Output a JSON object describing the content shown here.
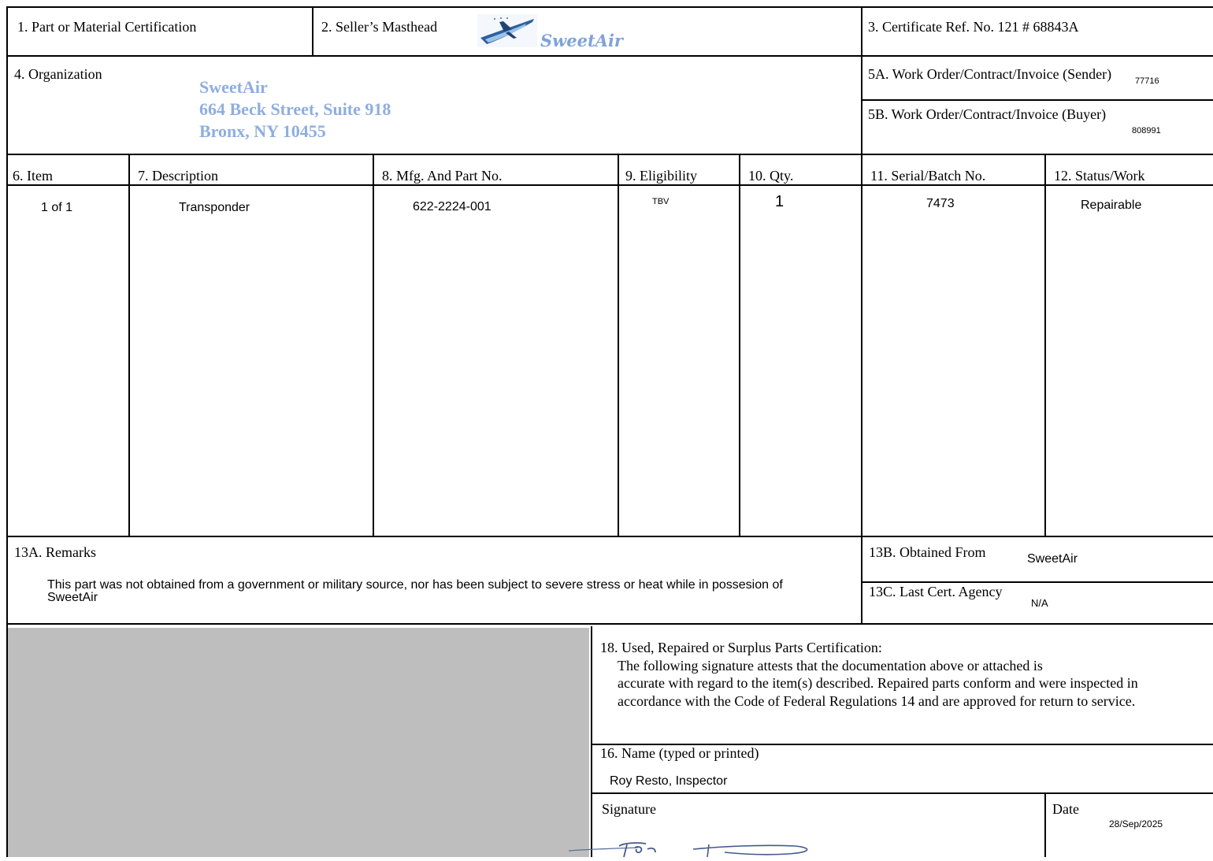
{
  "header": {
    "box1_label": "1. Part or Material Certification",
    "box2_label": "2. Seller’s Masthead",
    "masthead_brand": "SweetAir",
    "box3_label": "3. Certificate Ref. No. 121 # 68843A"
  },
  "organization": {
    "label": "4. Organization",
    "name": "SweetAir",
    "address_line1": "664 Beck Street, Suite 918",
    "address_line2": "Bronx, NY 10455"
  },
  "work_order": {
    "sender_label": "5A. Work Order/Contract/Invoice (Sender)",
    "sender_value": "77716",
    "buyer_label": "5B. Work Order/Contract/Invoice (Buyer)",
    "buyer_value": "808991"
  },
  "items_table": {
    "headers": [
      "6. Item",
      "7. Description",
      "8. Mfg. And Part No.",
      "9. Eligibility",
      "10. Qty.",
      "11. Serial/Batch No.",
      "12. Status/Work"
    ],
    "rows": [
      {
        "item": "1 of 1",
        "description": "Transponder",
        "part_no": "622-2224-001",
        "eligibility": "TBV",
        "qty": "1",
        "serial": "7473",
        "status": "Repairable"
      }
    ]
  },
  "remarks": {
    "label": "13A. Remarks",
    "text": "This part was not obtained from a government or military source, nor has been subject to severe stress or heat while in possesion of SweetAir"
  },
  "obtained_from": {
    "label": "13B. Obtained From",
    "value": "SweetAir"
  },
  "last_cert_agency": {
    "label": "13C. Last Cert. Agency",
    "value": "N/A"
  },
  "certification": {
    "heading": "18. Used, Repaired or Surplus Parts Certification:",
    "line1": "The following signature attests that the documentation above or attached is",
    "line2": "accurate with regard to the item(s) described. Repaired parts conform and were inspected in",
    "line3": "accordance with the Code of Federal Regulations 14 and are approved for return to service."
  },
  "name_field": {
    "label": "16.  Name (typed or printed)",
    "value": "Roy Resto, Inspector"
  },
  "signature": {
    "label": "Signature",
    "image": "handwritten-signature"
  },
  "date": {
    "label": "Date",
    "value": "28/Sep/2025"
  },
  "colors": {
    "masthead_blue": "#8eaee0",
    "redacted_grey": "#bebebe"
  }
}
